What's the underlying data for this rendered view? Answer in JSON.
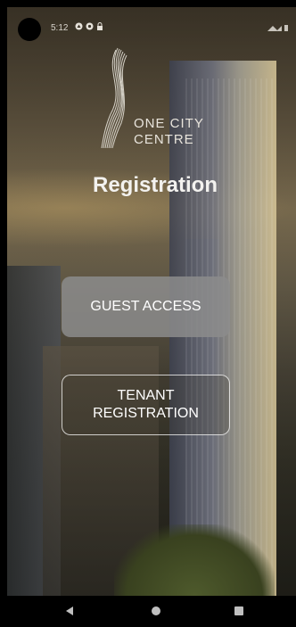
{
  "status_bar": {
    "time": "5:12",
    "icons": [
      "notification-a-icon",
      "notification-b-icon",
      "lock-icon",
      "wifi-icon",
      "signal-icon",
      "battery-icon"
    ]
  },
  "brand": {
    "line1": "ONE CITY",
    "line2": "CENTRE"
  },
  "page": {
    "title": "Registration"
  },
  "actions": {
    "guest_label": "GUEST ACCESS",
    "tenant_line1": "TENANT",
    "tenant_line2": "REGISTRATION"
  },
  "colors": {
    "primary_button": "#8c8c8c",
    "text": "#ffffff"
  }
}
